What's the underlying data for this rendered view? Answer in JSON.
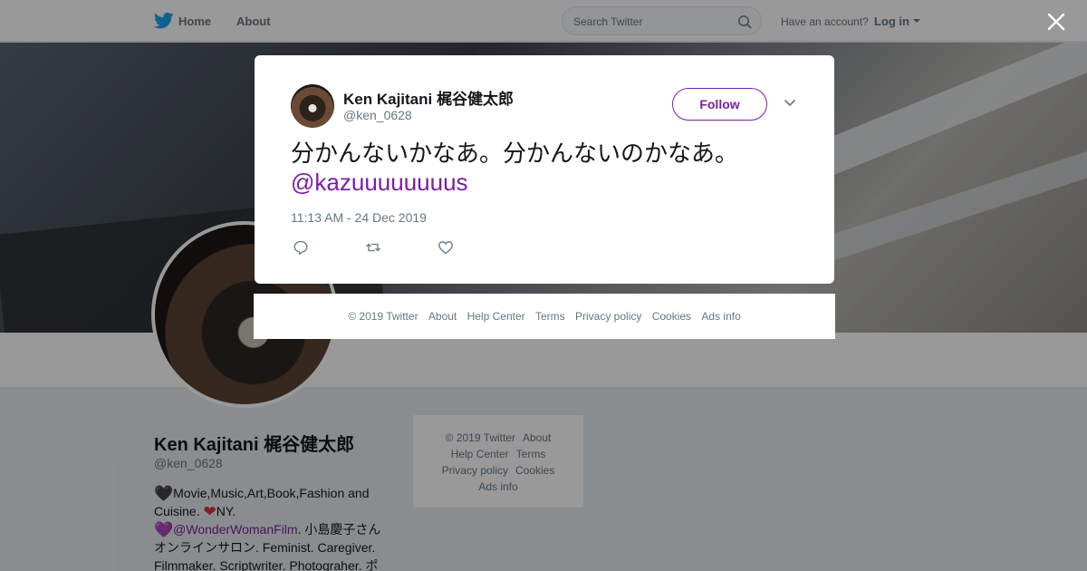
{
  "topbar": {
    "home_label": "Home",
    "about_label": "About",
    "search_placeholder": "Search Twitter",
    "have_account": "Have an account?",
    "login_label": "Log in"
  },
  "profile": {
    "name": "Ken Kajitani 梶谷健太郎",
    "handle": "@ken_0628",
    "bio_line1": "Movie,Music,Art,Book,Fashion and Cuisine.",
    "bio_line1_tail": "NY.",
    "bio_link": "@WonderWomanFilm",
    "bio_rest": ". 小島慶子さんオンラインサロン. Feminist. Caregiver. Filmmaker. Scriptwriter. Photograher. ポ",
    "heart1": "🖤",
    "heart2": "❤",
    "heart3": "💜"
  },
  "side_footer": {
    "copyright": "© 2019 Twitter",
    "about": "About",
    "help": "Help Center",
    "terms": "Terms",
    "privacy": "Privacy policy",
    "cookies": "Cookies",
    "ads": "Ads info"
  },
  "tweet": {
    "author_name": "Ken Kajitani 梶谷健太郎",
    "author_handle": "@ken_0628",
    "follow_label": "Follow",
    "text": "分かんないかなあ。分かんないのかなあ。",
    "mention": "@kazuuuuuuuus",
    "timestamp": "11:13 AM - 24 Dec 2019"
  },
  "modal_footer": {
    "copyright": "© 2019 Twitter",
    "about": "About",
    "help": "Help Center",
    "terms": "Terms",
    "privacy": "Privacy policy",
    "cookies": "Cookies",
    "ads": "Ads info"
  },
  "colors": {
    "link_accent": "#7b1fa2",
    "twitter_blue": "#1da1f2",
    "muted_text": "#657786"
  },
  "icons": {
    "brand": "twitter-bird-icon",
    "search": "search-icon",
    "close": "close-icon",
    "reply": "reply-icon",
    "retweet": "retweet-icon",
    "like": "heart-icon",
    "more": "chevron-down-icon"
  }
}
